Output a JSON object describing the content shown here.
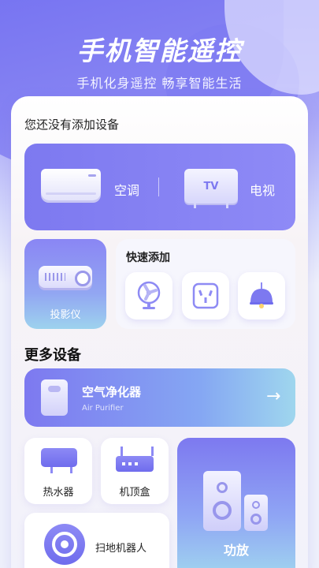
{
  "hero": {
    "title": "手机智能遥控",
    "subtitle": "手机化身遥控 畅享智能生活"
  },
  "devices": {
    "empty_title": "您还没有添加设备",
    "ac_label": "空调",
    "tv_label": "电视",
    "tv_badge": "TV",
    "projector_label": "投影仪"
  },
  "quick_add": {
    "title": "快速添加",
    "items": [
      "fan-icon",
      "socket-icon",
      "lamp-icon"
    ]
  },
  "more": {
    "title": "更多设备",
    "air_purifier": {
      "label": "空气净化器",
      "sub": "Air Purifier",
      "arrow": "→"
    },
    "heater_label": "热水器",
    "settop_label": "机顶盒",
    "amp_label": "功放",
    "robot_label": "扫地机器人"
  },
  "colors": {
    "accent": "#7d79f0",
    "accent_light": "#9fd6ee"
  }
}
